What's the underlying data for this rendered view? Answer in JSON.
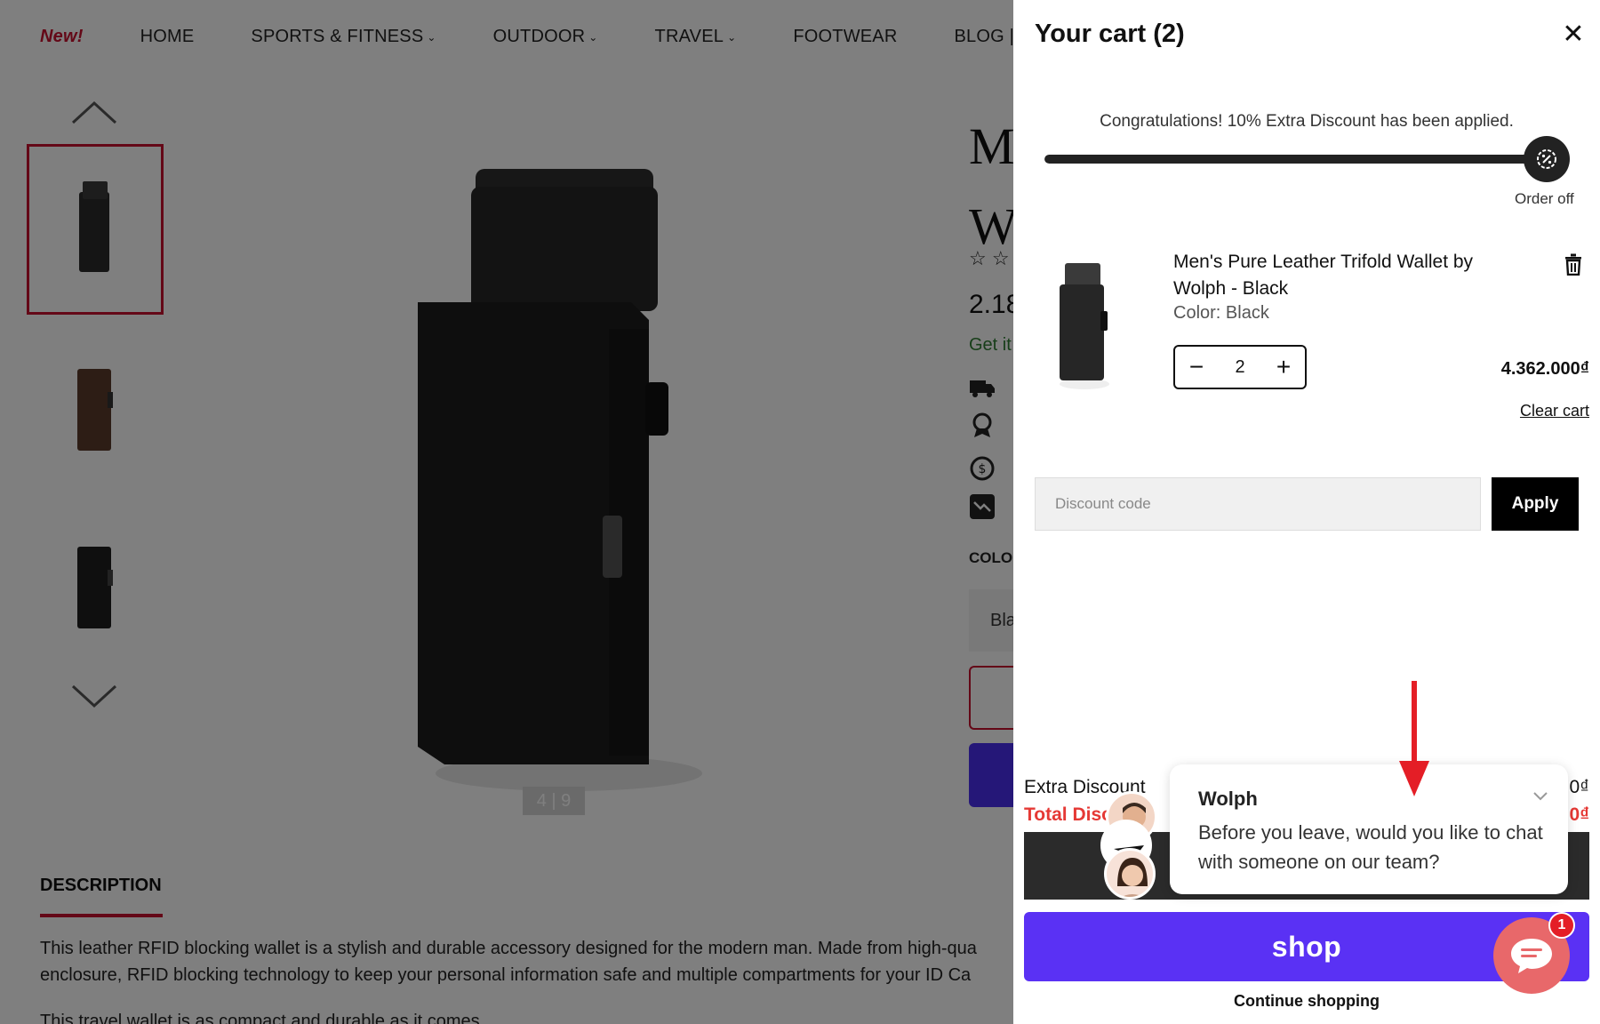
{
  "nav": {
    "items": [
      "New!",
      "HOME",
      "SPORTS & FITNESS",
      "OUTDOOR",
      "TRAVEL",
      "FOOTWEAR",
      "BLOG |"
    ]
  },
  "gallery": {
    "counter": "4 | 9"
  },
  "product_peek": {
    "title_line1": "M",
    "title_line2": "W",
    "price": "2.18",
    "get_it": "Get it",
    "color_label": "COLO",
    "select_value": "Bla"
  },
  "description": {
    "tab_label": "DESCRIPTION",
    "line1": "This leather RFID blocking wallet is a stylish and durable accessory designed for the modern man. Made from high-qua",
    "line2": "enclosure, RFID blocking technology to keep your personal information safe and multiple compartments for your ID Ca",
    "line3": "This travel wallet is as compact and durable as it comes"
  },
  "cart": {
    "title": "Your cart (2)",
    "congrats": "Congratulations! 10% Extra Discount has been applied.",
    "progress": 1.0,
    "order_off_label": "Order off",
    "item": {
      "name": "Men's Pure Leather Trifold Wallet by Wolph - Black",
      "color": "Color: Black",
      "quantity": "2",
      "price": "4.362.000₫"
    },
    "clear_cart": "Clear cart",
    "discount_placeholder": "Discount code",
    "apply_label": "Apply",
    "extra_discount_label": "Extra Discount",
    "total_discount_label": "Total Disc",
    "extra_discount_value": "0₫",
    "total_discount_value": "0₫",
    "shop_label": "shop",
    "continue_label": "Continue shopping"
  },
  "chat": {
    "name": "Wolph",
    "message": "Before you leave, would you like to chat with someone on our team?",
    "unread_count": "1"
  },
  "colors": {
    "accent_red": "#c8102e",
    "shop_purple": "#5a31f4",
    "discount_red": "#e53935",
    "chat_pink": "#e8686a"
  }
}
